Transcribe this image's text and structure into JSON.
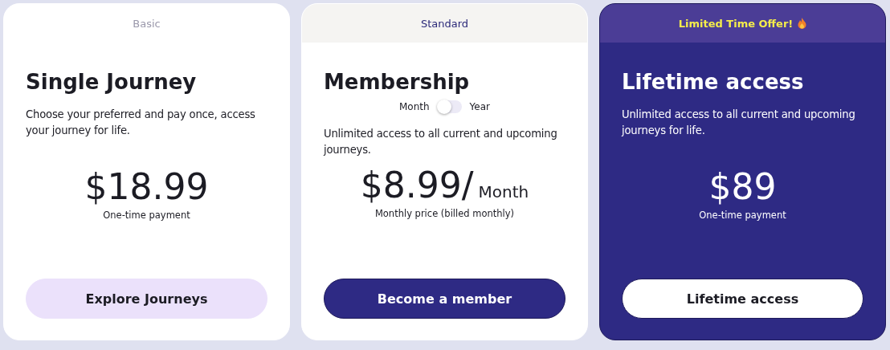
{
  "plans": [
    {
      "kind": "basic",
      "badge": "Basic",
      "title": "Single Journey",
      "description": "Choose your preferred and pay once, access your journey for life.",
      "price": "$18.99",
      "price_note": "One-time payment",
      "button": "Explore Journeys"
    },
    {
      "kind": "standard",
      "badge": "Standard",
      "title": "Membership",
      "toggle": {
        "left": "Month",
        "right": "Year",
        "on": false
      },
      "description": "Unlimited access to all current and upcoming journeys.",
      "price": "$8.99/",
      "period": "Month",
      "price_note": "Monthly price (billed monthly)",
      "button": "Become a member"
    },
    {
      "kind": "featured",
      "badge": "Limited Time Offer!",
      "title": "Lifetime access",
      "description": "Unlimited access to all current and upcoming journeys for life.",
      "price": "$89",
      "price_note": "One-time payment",
      "button": "Lifetime access"
    }
  ]
}
